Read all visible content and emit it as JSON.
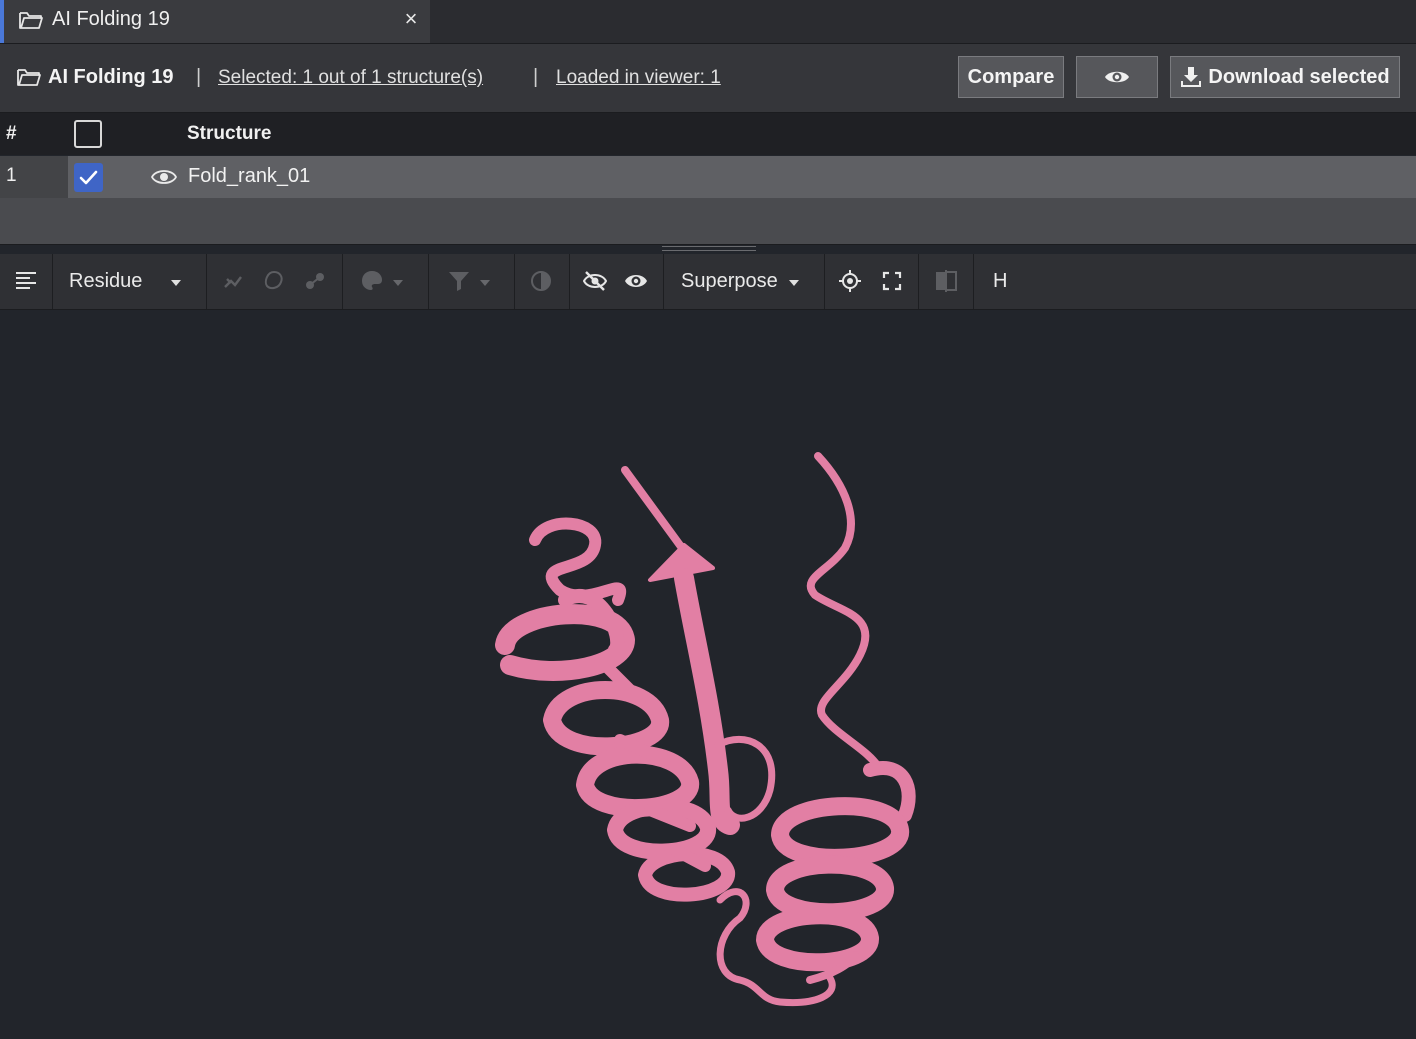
{
  "tab": {
    "title": "AI Folding 19",
    "close": "×"
  },
  "header": {
    "project": "AI Folding 19",
    "separator": "|",
    "selected": "Selected: 1 out of 1 structure(s)",
    "loaded": "Loaded in viewer: 1",
    "compare_label": "Compare",
    "download_label": "Download selected"
  },
  "table": {
    "col_num": "#",
    "col_structure": "Structure",
    "rows": [
      {
        "num": "1",
        "name": "Fold_rank_01",
        "checked": true,
        "visible": true
      }
    ]
  },
  "toolbar": {
    "mode_label": "Residue",
    "superpose_label": "Superpose",
    "h_label": "H"
  },
  "viewer": {
    "ribbon_color": "#e27fa4",
    "background": "#22252b"
  },
  "colors": {
    "accent": "#3f65c6",
    "tab_indicator": "#4a78d8"
  }
}
